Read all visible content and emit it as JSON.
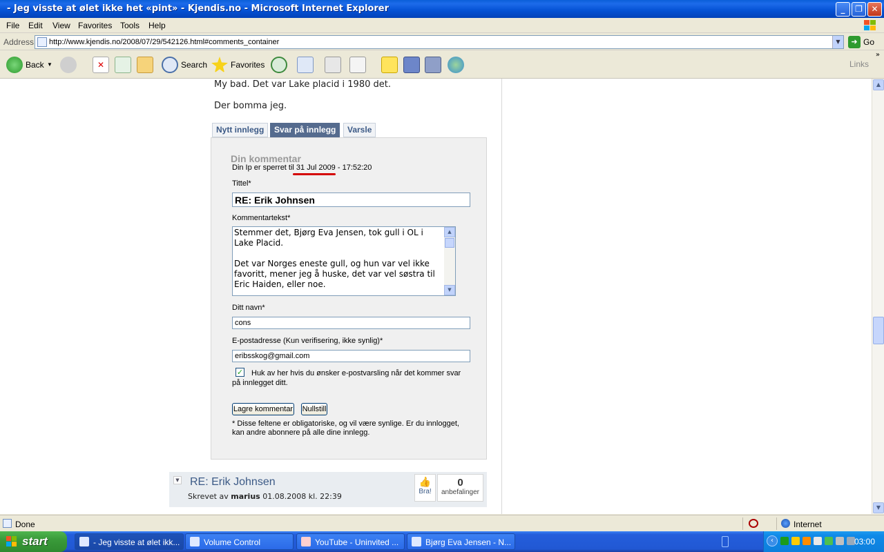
{
  "window": {
    "title": "- Jeg visste at ølet ikke het «pint» - Kjendis.no - Microsoft Internet Explorer"
  },
  "menu": [
    "File",
    "Edit",
    "View",
    "Favorites",
    "Tools",
    "Help"
  ],
  "address": {
    "label": "Address",
    "url": "http://www.kjendis.no/2008/07/29/542126.html#comments_container",
    "go": "Go"
  },
  "toolbar": {
    "back": "Back",
    "search": "Search",
    "favorites": "Favorites",
    "links": "Links"
  },
  "page": {
    "text1": "My bad. Det var Lake placid i 1980 det.",
    "text2": "Der bomma jeg.",
    "tabs": [
      "Nytt innlegg",
      "Svar på innlegg",
      "Varsle"
    ],
    "form": {
      "heading": "Din kommentar",
      "ip_note_prefix": "Din Ip er sperret til ",
      "ip_note_date": "31 Jul 2009",
      "ip_note_suffix": " - 17:52:20",
      "title_label": "Tittel*",
      "title_value": "RE: Erik Johnsen",
      "comment_label": "Kommentartekst*",
      "comment_value": "Stemmer det, Bjørg Eva Jensen, tok gull i OL i Lake Placid.\n\nDet var Norges eneste gull, og hun var vel ikke favoritt, mener jeg å huske, det var vel søstra til Eric Haiden, eller noe.",
      "name_label": "Ditt navn*",
      "name_value": "cons",
      "email_label": "E-postadresse (Kun verifisering, ikke synlig)*",
      "email_value": "eribsskog@gmail.com",
      "notify_text": "Huk av her hvis du ønsker e-postvarsling når det kommer svar på innlegget ditt.",
      "notify_checked": true,
      "save_button": "Lagre kommentar",
      "reset_button": "Nullstill",
      "disclaimer": "* Disse feltene er obligatoriske, og vil være synlige. Er du innlogget, kan andre abonnere på alle dine innlegg."
    },
    "comment": {
      "title": "RE: Erik Johnsen",
      "byline_prefix": "Skrevet av ",
      "author": "marius",
      "date": " 01.08.2008 kl. 22:39",
      "like_label": "Bra!",
      "count": "0",
      "count_label": "anbefalinger"
    }
  },
  "status": {
    "text": "Done",
    "zone": "Internet"
  },
  "taskbar": {
    "start": "start",
    "tasks": [
      "- Jeg visste at ølet ikk...",
      "Volume Control",
      "YouTube - Uninvited ...",
      "Bjørg Eva Jensen - N..."
    ],
    "clock": "03:00"
  }
}
